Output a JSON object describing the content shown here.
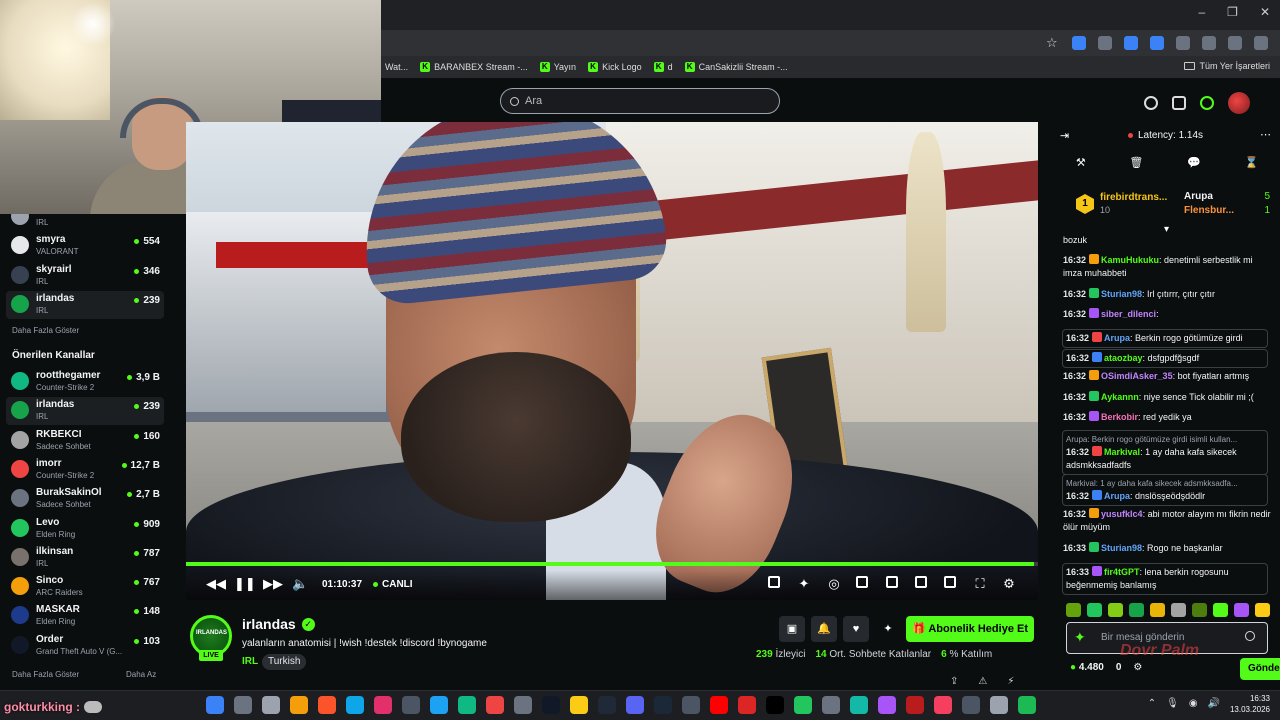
{
  "window": {
    "controls": [
      "–",
      "❐",
      "✕"
    ]
  },
  "bookmarks": [
    {
      "label": "Wat...",
      "kick": false
    },
    {
      "label": "BARANBEX Stream -...",
      "kick": true
    },
    {
      "label": "Yayın",
      "kick": true
    },
    {
      "label": "Kick Logo",
      "kick": true
    },
    {
      "label": "d",
      "kick": true
    },
    {
      "label": "CanSakizlii Stream -...",
      "kick": true
    }
  ],
  "bookmarks_folder": "Tüm Yer İşaretleri",
  "search": {
    "placeholder": "Ara"
  },
  "sidebar": {
    "followed": [
      {
        "name": "",
        "category": "IRL",
        "viewers": ""
      },
      {
        "name": "smyra",
        "category": "VALORANT",
        "viewers": "554"
      },
      {
        "name": "skyrairl",
        "category": "IRL",
        "viewers": "346"
      },
      {
        "name": "irlandas",
        "category": "IRL",
        "viewers": "239"
      }
    ],
    "show_more": "Daha Fazla Göster",
    "recommended_title": "Önerilen Kanallar",
    "recommended": [
      {
        "name": "rootthegamer",
        "category": "Counter-Strike 2",
        "viewers": "3,9 B"
      },
      {
        "name": "irlandas",
        "category": "IRL",
        "viewers": "239"
      },
      {
        "name": "RKBEKCI",
        "category": "Sadece Sohbet",
        "viewers": "160"
      },
      {
        "name": "imorr",
        "category": "Counter-Strike 2",
        "viewers": "12,7 B"
      },
      {
        "name": "BurakSakinOl",
        "category": "Sadece Sohbet",
        "viewers": "2,7 B"
      },
      {
        "name": "Levo",
        "category": "Elden Ring",
        "viewers": "909"
      },
      {
        "name": "ilkinsan",
        "category": "IRL",
        "viewers": "787"
      },
      {
        "name": "Sinco",
        "category": "ARC Raiders",
        "viewers": "767"
      },
      {
        "name": "MASKAR",
        "category": "Elden Ring",
        "viewers": "148"
      },
      {
        "name": "Order",
        "category": "Grand Theft Auto V (G...",
        "viewers": "103"
      }
    ],
    "show_more_2": "Daha Fazla Göster",
    "show_less": "Daha Az"
  },
  "player": {
    "time": "01:10:37",
    "live_label": "CANLI",
    "progress": 0.995
  },
  "stream": {
    "avatar_text": "IRLANDAS",
    "live_badge": "LIVE",
    "channel": "irlandas",
    "title": "yalanların anatomisi | !wish !destek !discord !bynogame",
    "category": "IRL",
    "tag": "Turkish",
    "subscribe_label": "Abonelik Hediye Et",
    "viewers": "239",
    "viewers_label": "İzleyici",
    "chatters": "14",
    "chatters_label": "Ort. Sohbete Katılanlar",
    "participation": "6",
    "participation_label": "% Katılım"
  },
  "chat": {
    "latency": "Latency: 1.14s",
    "pinned": {
      "name": "firebirdtrans...",
      "sub": "10",
      "rank": "1",
      "r1_name": "Arupa",
      "r1_count": "5",
      "r2_name": "Flensbur...",
      "r2_count": "1"
    },
    "messages": [
      {
        "time": "",
        "user": "",
        "color": "#f3f4f6",
        "text": "bozuk"
      },
      {
        "time": "16:32",
        "user": "KamuHukuku",
        "color": "#53fc18",
        "text": ": denetimli serbestlik mi imza muhabbeti"
      },
      {
        "time": "16:32",
        "user": "Sturian98",
        "color": "#60a5fa",
        "text": ": Irl çıtırrr, çıtır çıtır"
      },
      {
        "time": "16:32",
        "user": "siber_dilenci",
        "color": "#c084fc",
        "text": ":"
      },
      {
        "time": "16:32",
        "user": "Arupa",
        "color": "#60a5fa",
        "text": ": Berkin rogo götümüze girdi"
      },
      {
        "time": "16:32",
        "user": "ataozbay",
        "color": "#53fc18",
        "text": ": dsfgpdfğsgdf"
      },
      {
        "time": "16:32",
        "user": "OSimdiAsker_35",
        "color": "#c084fc",
        "text": ": bot fiyatları artmış"
      },
      {
        "time": "16:32",
        "user": "Aykannn",
        "color": "#53fc18",
        "text": ": niye sence Tick olabilir mi ;("
      },
      {
        "time": "16:32",
        "user": "Berkobir",
        "color": "#f472b6",
        "text": ": red yedik ya"
      },
      {
        "reply": "Arupa: Berkin rogo götümüze girdi isimli kullan...",
        "time": "16:32",
        "user": "Markival",
        "color": "#53fc18",
        "text": ": 1 ay daha kafa sikecek adsmkksadfadfs"
      },
      {
        "reply": "Markival: 1 ay daha kafa sikecek adsmkksadfa...",
        "time": "16:32",
        "user": "Arupa",
        "color": "#60a5fa",
        "text": ": dnslösşeödşdödlr"
      },
      {
        "time": "16:32",
        "user": "yusufklc4",
        "color": "#c084fc",
        "text": ": abi motor alayım mı fikrin nedir ölür müyüm"
      },
      {
        "time": "16:33",
        "user": "Sturian98",
        "color": "#60a5fa",
        "text": ": Rogo ne başkanlar"
      },
      {
        "time": "16:33",
        "user": "fir4tGPT",
        "color": "#53fc18",
        "text": ": lena berkin rogosunu beğenmemiş banlamış"
      }
    ],
    "input_placeholder": "Bir mesaj gönderin",
    "balance": "4.480",
    "count": "0",
    "send_label": "Gönder",
    "watermark": "Dovr Palm"
  },
  "overlay": {
    "username": "gokturkking :"
  },
  "clock": {
    "time": "16:33",
    "date": "13.03.2026"
  },
  "colors": {
    "accent": "#53fc18",
    "bg": "#0b0e0f",
    "panel": "#1c1f22"
  }
}
